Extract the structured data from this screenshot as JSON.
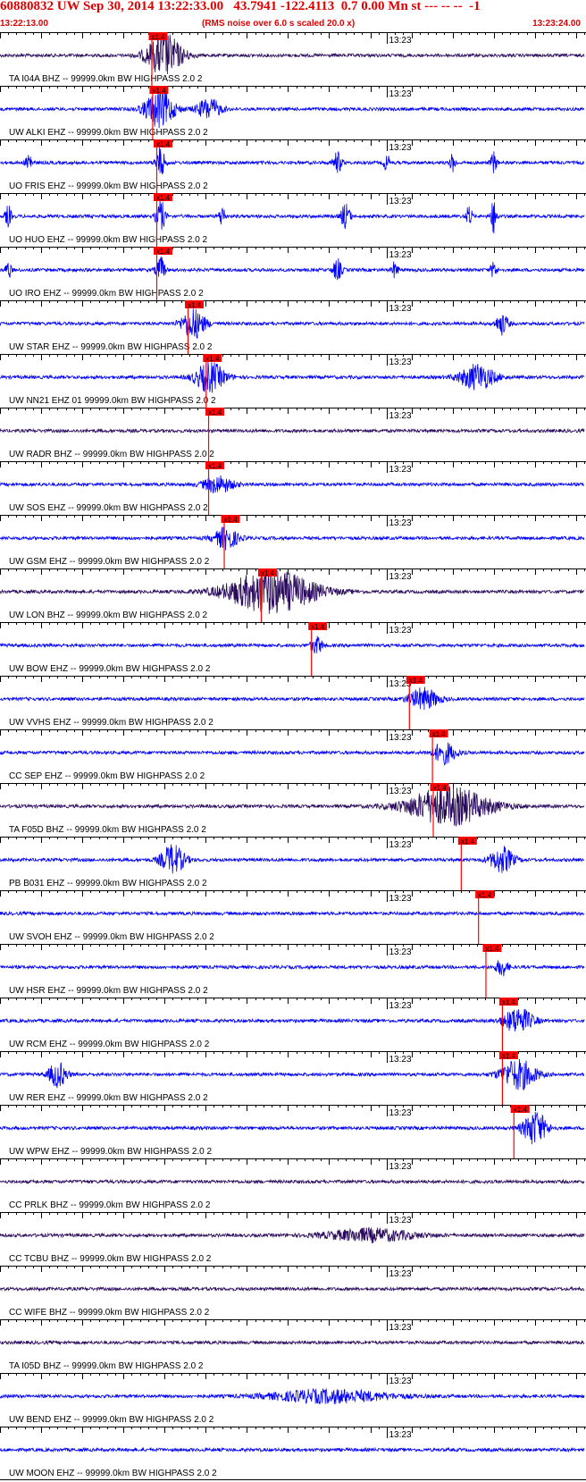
{
  "header": {
    "title": "60880832 UW Sep 30, 2014 13:22:33.00   43.7941 -122.4113  0.7 0.00 Mn st --- -- --  -1",
    "start_time": "13:22:13.00",
    "scale_note": "(RMS noise over 6.0 s scaled 20.0 x)",
    "end_time": "13:23:24.00"
  },
  "colors": {
    "title": "#e00000",
    "trace_blue": "#0000ff",
    "trace_navy": "#2a0a5c",
    "pick": "#ff0000",
    "grid": "#000000"
  },
  "chart_data": {
    "type": "line",
    "description_of_axes": "time axis 13:22:13.00 to 13:23:24.00 (71 s)",
    "time_start_s": 0,
    "time_end_s": 71,
    "minute_tick_label": "13:23",
    "minute_tick_time_s": 47,
    "pick_label": "x1.4",
    "channels": [
      {
        "label": "TA I04A BHZ -- 99999.0km BW  HIGHPASS  2.0  2",
        "color": "navy",
        "pick_s": 18.4,
        "events": [
          [
            20.0,
            1.0,
            6.0
          ]
        ]
      },
      {
        "label": "UW ALKI EHZ -- 99999.0km BW  HIGHPASS  2.0  2",
        "color": "blue",
        "pick_s": 18.5,
        "events": [
          [
            19.4,
            0.9,
            5.0
          ],
          [
            25.4,
            0.5,
            4.0
          ]
        ]
      },
      {
        "label": "UO FRIS EHZ -- 99999.0km BW  HIGHPASS  2.0  2",
        "color": "blue",
        "pick_s": 19.0,
        "events": [
          [
            3.5,
            0.5,
            1.0
          ],
          [
            19.5,
            0.7,
            1.5
          ],
          [
            41.0,
            0.5,
            1.5
          ],
          [
            47.0,
            0.4,
            1.0
          ],
          [
            55.0,
            0.4,
            1.0
          ],
          [
            60.0,
            0.5,
            1.0
          ]
        ]
      },
      {
        "label": "UO HUO EHZ -- 99999.0km BW  HIGHPASS  2.0  2",
        "color": "blue",
        "pick_s": 19.0,
        "events": [
          [
            1.0,
            0.5,
            1.0
          ],
          [
            19.5,
            0.8,
            1.5
          ],
          [
            27.0,
            0.5,
            1.0
          ],
          [
            42.0,
            0.6,
            1.5
          ],
          [
            57.0,
            0.5,
            1.0
          ],
          [
            60.0,
            0.8,
            1.0
          ]
        ]
      },
      {
        "label": "UO IRO EHZ -- 99999.0km BW  HIGHPASS  2.0  2",
        "color": "blue",
        "pick_s": 19.0,
        "events": [
          [
            1.0,
            0.4,
            1.0
          ],
          [
            19.5,
            0.6,
            1.5
          ],
          [
            41.0,
            0.5,
            1.5
          ],
          [
            48.0,
            0.4,
            1.0
          ],
          [
            60.0,
            0.4,
            1.0
          ]
        ]
      },
      {
        "label": "UW STAR EHZ -- 99999.0km BW  HIGHPASS  2.0  2",
        "color": "blue",
        "pick_s": 22.8,
        "events": [
          [
            23.5,
            0.7,
            4.0
          ],
          [
            61.0,
            0.5,
            2.0
          ]
        ]
      },
      {
        "label": "UW NN21 EHZ 01 99999.0km BW  HIGHPASS  2.0  2",
        "color": "blue",
        "pick_s": 25.0,
        "events": [
          [
            25.5,
            0.7,
            5.0
          ],
          [
            58.0,
            0.6,
            6.0
          ]
        ]
      },
      {
        "label": "UW RADR BHZ -- 99999.0km BW  HIGHPASS  2.0  2",
        "color": "navy",
        "pick_s": 25.3,
        "events": []
      },
      {
        "label": "UW SOS EHZ -- 99999.0km BW  HIGHPASS  2.0  2",
        "color": "blue",
        "pick_s": 25.3,
        "events": [
          [
            26.5,
            0.4,
            5.0
          ]
        ]
      },
      {
        "label": "UW GSM EHZ -- 99999.0km BW  HIGHPASS  2.0  2",
        "color": "blue",
        "pick_s": 27.2,
        "events": [
          [
            27.5,
            0.5,
            4.0
          ]
        ]
      },
      {
        "label": "UW LON BHZ -- 99999.0km BW  HIGHPASS  2.0  2",
        "color": "navy",
        "pick_s": 31.7,
        "events": [
          [
            33.0,
            1.0,
            15.0
          ]
        ]
      },
      {
        "label": "UW BOW EHZ -- 99999.0km BW  HIGHPASS  2.0  2",
        "color": "blue",
        "pick_s": 37.8,
        "events": [
          [
            38.5,
            0.4,
            2.0
          ]
        ]
      },
      {
        "label": "UW VVHS EHZ -- 99999.0km BW  HIGHPASS  2.0  2",
        "color": "blue",
        "pick_s": 49.7,
        "events": [
          [
            51.5,
            0.5,
            5.0
          ]
        ]
      },
      {
        "label": "CC SEP EHZ -- 99999.0km BW  HIGHPASS  2.0  2",
        "color": "blue",
        "pick_s": 52.5,
        "events": [
          [
            54.0,
            0.5,
            4.0
          ]
        ]
      },
      {
        "label": "TA F05D BHZ -- 99999.0km BW  HIGHPASS  2.0  2",
        "color": "navy",
        "pick_s": 52.6,
        "events": [
          [
            54.5,
            0.9,
            14.0
          ]
        ]
      },
      {
        "label": "PB B031 EHZ -- 99999.0km BW  HIGHPASS  2.0  2",
        "color": "blue",
        "pick_s": 56.0,
        "events": [
          [
            21.0,
            0.7,
            4.0
          ],
          [
            61.0,
            0.6,
            4.0
          ]
        ]
      },
      {
        "label": "UW SVOH EHZ -- 99999.0km BW  HIGHPASS  2.0  2",
        "color": "blue",
        "pick_s": 58.1,
        "events": []
      },
      {
        "label": "UW HSR EHZ -- 99999.0km BW  HIGHPASS  2.0  2",
        "color": "blue",
        "pick_s": 59.0,
        "events": [
          [
            61.0,
            0.4,
            2.0
          ]
        ]
      },
      {
        "label": "UW RCM EHZ -- 99999.0km BW  HIGHPASS  2.0  2",
        "color": "blue",
        "pick_s": 61.0,
        "events": [
          [
            63.0,
            0.6,
            5.0
          ]
        ]
      },
      {
        "label": "UW RER EHZ -- 99999.0km BW  HIGHPASS  2.0  2",
        "color": "blue",
        "pick_s": 61.0,
        "events": [
          [
            7.0,
            0.6,
            3.0
          ],
          [
            63.0,
            0.7,
            6.0
          ]
        ]
      },
      {
        "label": "UW WPW EHZ -- 99999.0km BW  HIGHPASS  2.0  2",
        "color": "blue",
        "pick_s": 62.4,
        "events": [
          [
            65.0,
            0.8,
            4.0
          ]
        ]
      },
      {
        "label": "CC PRLK BHZ -- 99999.0km BW  HIGHPASS  2.0  2",
        "color": "navy",
        "pick_s": null,
        "events": []
      },
      {
        "label": "CC TCBU BHZ -- 99999.0km BW  HIGHPASS  2.0  2",
        "color": "navy",
        "pick_s": null,
        "events": [
          [
            45.0,
            0.3,
            15.0
          ]
        ]
      },
      {
        "label": "CC WIFE BHZ -- 99999.0km BW  HIGHPASS  2.0  2",
        "color": "navy",
        "pick_s": null,
        "events": []
      },
      {
        "label": "TA I05D BHZ -- 99999.0km BW  HIGHPASS  2.0  2",
        "color": "navy",
        "pick_s": null,
        "events": []
      },
      {
        "label": "UW BEND EHZ -- 99999.0km BW  HIGHPASS  2.0  2",
        "color": "blue",
        "pick_s": null,
        "events": [
          [
            40.0,
            0.3,
            20.0
          ]
        ]
      },
      {
        "label": "UW MOON EHZ -- 99999.0km BW  HIGHPASS  2.0  2",
        "color": "blue",
        "pick_s": null,
        "events": []
      }
    ]
  }
}
